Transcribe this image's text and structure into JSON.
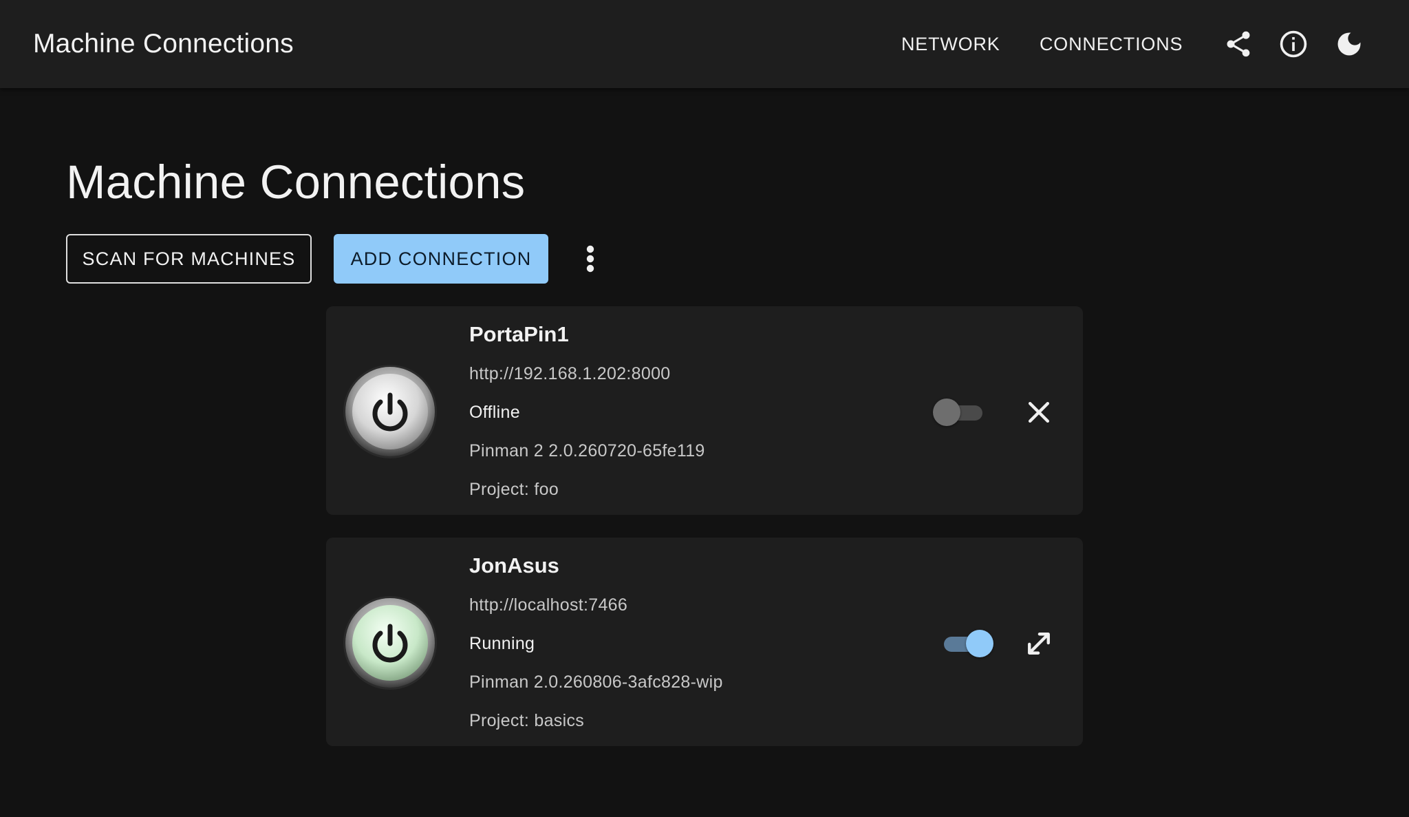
{
  "appbar": {
    "title": "Machine Connections",
    "nav": [
      "NETWORK",
      "CONNECTIONS"
    ],
    "icons": [
      "share-icon",
      "info-icon",
      "dark-mode-icon"
    ]
  },
  "main": {
    "title": "Machine Connections",
    "scan_label": "SCAN FOR MACHINES",
    "add_label": "ADD CONNECTION",
    "more_icon": "more-vert-icon"
  },
  "connections": [
    {
      "name": "PortaPin1",
      "url": "http://192.168.1.202:8000",
      "status": "Offline",
      "version": "Pinman 2 2.0.260720-65fe119",
      "project": "Project: foo",
      "enabled": false,
      "action_icon": "close-icon",
      "power_color": "#d6d6d6"
    },
    {
      "name": "JonAsus",
      "url": "http://localhost:7466",
      "status": "Running",
      "version": "Pinman 2.0.260806-3afc828-wip",
      "project": "Project: basics",
      "enabled": true,
      "action_icon": "expand-icon",
      "power_color": "#c8e8c8"
    }
  ],
  "colors": {
    "background": "#121212",
    "appbar": "#1e1e1e",
    "card": "#1e1e1e",
    "accent": "#90caf9"
  }
}
